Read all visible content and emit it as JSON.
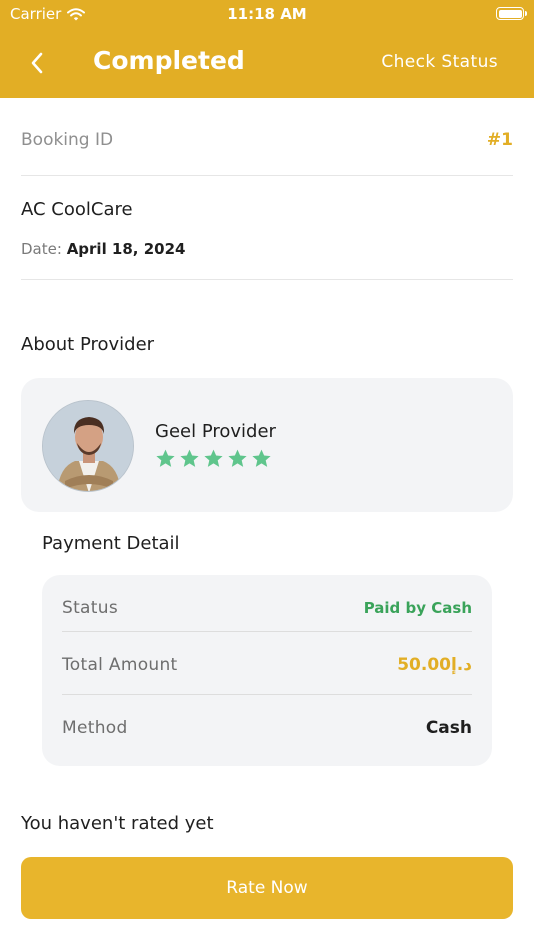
{
  "status_bar": {
    "carrier": "Carrier",
    "time": "11:18 AM"
  },
  "header": {
    "title": "Completed",
    "action": "Check Status"
  },
  "booking": {
    "label": "Booking ID",
    "value": "#1"
  },
  "service": {
    "name": "AC CoolCare",
    "date_label": "Date:",
    "date_value": "April 18, 2024"
  },
  "provider": {
    "section_title": "About Provider",
    "name": "Geel Provider",
    "rating": 5,
    "max_rating": 5
  },
  "payment": {
    "section_title": "Payment Detail",
    "rows": [
      {
        "label": "Status",
        "value": "Paid by Cash"
      },
      {
        "label": "Total Amount",
        "value": "50.00د.إ"
      },
      {
        "label": "Method",
        "value": "Cash"
      }
    ]
  },
  "rating": {
    "note": "You haven't rated yet",
    "button": "Rate Now"
  },
  "colors": {
    "primary": "#e2ae25",
    "success": "#3aa35a",
    "star": "#5fc58c",
    "card_bg": "#f3f4f6"
  },
  "icons": {
    "back": "chevron-left-icon",
    "wifi": "wifi-icon",
    "battery": "battery-icon",
    "star": "star-icon"
  }
}
